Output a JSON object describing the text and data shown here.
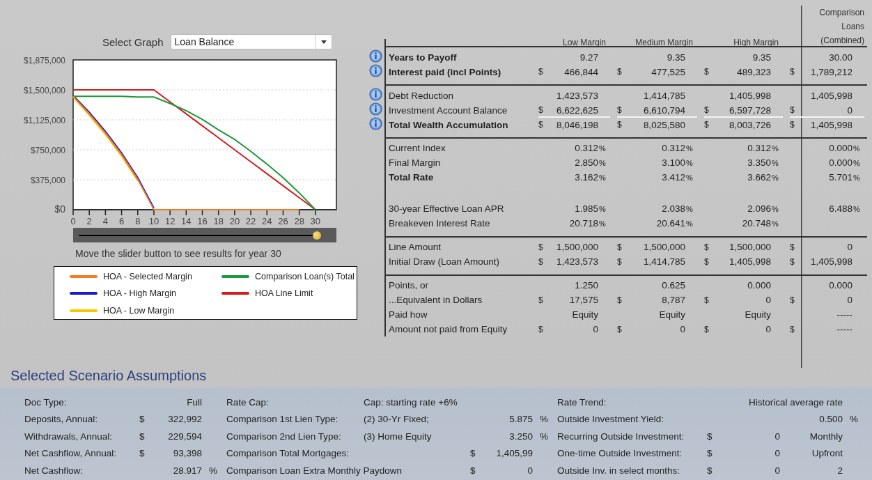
{
  "graph_selector": {
    "label": "Select Graph",
    "value": "Loan Balance"
  },
  "chart": {
    "chart_data": {
      "type": "line",
      "grid": true,
      "x": [
        0,
        2,
        4,
        6,
        8,
        10,
        12,
        14,
        16,
        18,
        20,
        22,
        24,
        26,
        28,
        30
      ],
      "xlim": [
        0,
        32.6
      ],
      "ylim": [
        0,
        1875000
      ],
      "xticks": [
        0,
        2,
        4,
        6,
        8,
        10,
        12,
        14,
        16,
        18,
        20,
        22,
        24,
        26,
        28,
        30
      ],
      "yticks": [
        {
          "value": 0,
          "label": "$0"
        },
        {
          "value": 375000,
          "label": "$375,000"
        },
        {
          "value": 750000,
          "label": "$750,000"
        },
        {
          "value": 1125000,
          "label": "$1,125,000"
        },
        {
          "value": 1500000,
          "label": "$1,500,000"
        },
        {
          "value": 1875000,
          "label": "$1,875,000"
        }
      ],
      "series": [
        {
          "name": "HOA - Selected Margin",
          "color": "#f47b20",
          "values": [
            1420000,
            1200000,
            960000,
            690000,
            380000,
            0,
            0,
            0,
            0,
            0,
            0,
            0,
            0,
            0,
            0,
            null
          ]
        },
        {
          "name": "Comparison Loan(s) Total",
          "color": "#1a9a3a",
          "values": [
            1420000,
            1420000,
            1420000,
            1420000,
            1410000,
            1410000,
            1330000,
            1240000,
            1130000,
            1000000,
            880000,
            730000,
            570000,
            400000,
            210000,
            0
          ]
        },
        {
          "name": "HOA - High Margin",
          "color": "#1818d8",
          "values": [
            1430000,
            1220000,
            980000,
            710000,
            400000,
            20000,
            null,
            null,
            null,
            null,
            null,
            null,
            null,
            null,
            null,
            null
          ]
        },
        {
          "name": "HOA Line Limit",
          "color": "#d41c1c",
          "values": [
            1500000,
            1500000,
            1500000,
            1500000,
            1500000,
            1500000,
            1350000,
            1200000,
            1050000,
            900000,
            750000,
            600000,
            450000,
            300000,
            150000,
            0
          ]
        },
        {
          "name": "HOA - Low Margin",
          "color": "#f5c800",
          "values": [
            1410000,
            1180000,
            940000,
            670000,
            360000,
            null,
            null,
            null,
            null,
            null,
            null,
            null,
            null,
            null,
            null,
            null
          ]
        }
      ]
    }
  },
  "slider": {
    "level": 1,
    "caption": "Move the slider button to see results for year  30"
  },
  "table": {
    "columns": [
      "Low Margin",
      "Medium Margin",
      "High Margin",
      "Comparison Loans (Combined)"
    ],
    "sections": [
      {
        "groups": [
          [
            {
              "label": "Years to Payoff",
              "info": true,
              "bold": true,
              "cells": [
                {
                  "value": "9.27"
                },
                {
                  "value": "9.35"
                },
                {
                  "value": "9.35"
                },
                {
                  "value": "30.00"
                }
              ]
            },
            {
              "label": "Interest paid (incl Points)",
              "info": true,
              "bold": true,
              "cells": [
                {
                  "currency": "$",
                  "value": "466,844"
                },
                {
                  "currency": "$",
                  "value": "477,525"
                },
                {
                  "currency": "$",
                  "value": "489,323"
                },
                {
                  "currency": "$",
                  "value": "1,789,212"
                }
              ]
            }
          ]
        ]
      },
      {
        "groups": [
          [
            {
              "label": "Debt Reduction",
              "info": true,
              "bold": false,
              "underline": false,
              "cells": [
                {
                  "value": "1,423,573"
                },
                {
                  "value": "1,414,785"
                },
                {
                  "value": "1,405,998"
                },
                {
                  "value": "1,405,998"
                }
              ]
            },
            {
              "label": "Investment Account Balance",
              "info": true,
              "bold": false,
              "underline": true,
              "cells": [
                {
                  "currency": "$",
                  "value": "6,622,625"
                },
                {
                  "currency": "$",
                  "value": "6,610,794"
                },
                {
                  "currency": "$",
                  "value": "6,597,728"
                },
                {
                  "currency": "$",
                  "value": "0"
                }
              ]
            },
            {
              "label": "Total Wealth Accumulation",
              "info": true,
              "bold": true,
              "underline": false,
              "cells": [
                {
                  "currency": "$",
                  "value": "8,046,198"
                },
                {
                  "currency": "$",
                  "value": "8,025,580"
                },
                {
                  "currency": "$",
                  "value": "8,003,726"
                },
                {
                  "currency": "$",
                  "value": "1,405,998"
                }
              ]
            }
          ]
        ]
      },
      {
        "groups": [
          [
            {
              "label": "Current Index",
              "bold": false,
              "cells": [
                {
                  "value": "0.312",
                  "unit": "%"
                },
                {
                  "value": "0.312",
                  "unit": "%"
                },
                {
                  "value": "0.312",
                  "unit": "%"
                },
                {
                  "value": "0.000",
                  "unit": "%"
                }
              ]
            },
            {
              "label": "Final Margin",
              "bold": false,
              "cells": [
                {
                  "value": "2.850",
                  "unit": "%"
                },
                {
                  "value": "3.100",
                  "unit": "%"
                },
                {
                  "value": "3.350",
                  "unit": "%"
                },
                {
                  "value": "0.000",
                  "unit": "%"
                }
              ]
            },
            {
              "label": "Total Rate",
              "bold": true,
              "cells": [
                {
                  "value": "3.162",
                  "unit": "%"
                },
                {
                  "value": "3.412",
                  "unit": "%"
                },
                {
                  "value": "3.662",
                  "unit": "%"
                },
                {
                  "value": "5.701",
                  "unit": "%"
                }
              ]
            }
          ],
          [
            {
              "label": "30-year Effective Loan APR",
              "cells": [
                {
                  "value": "1.985",
                  "unit": "%"
                },
                {
                  "value": "2.038",
                  "unit": "%"
                },
                {
                  "value": "2.096",
                  "unit": "%"
                },
                {
                  "value": "6.488",
                  "unit": "%"
                }
              ]
            },
            {
              "label": "Breakeven Interest Rate",
              "cells": [
                {
                  "value": "20.718",
                  "unit": "%"
                },
                {
                  "value": "20.641",
                  "unit": "%"
                },
                {
                  "value": "20.748",
                  "unit": "%"
                }
              ]
            }
          ]
        ]
      },
      {
        "groups": [
          [
            {
              "label": "Line Amount",
              "cells": [
                {
                  "currency": "$",
                  "value": "1,500,000"
                },
                {
                  "currency": "$",
                  "value": "1,500,000"
                },
                {
                  "currency": "$",
                  "value": "1,500,000"
                },
                {
                  "currency": "$",
                  "value": "0"
                }
              ]
            },
            {
              "label": "Initial Draw (Loan Amount)",
              "cells": [
                {
                  "currency": "$",
                  "value": "1,423,573"
                },
                {
                  "currency": "$",
                  "value": "1,414,785"
                },
                {
                  "currency": "$",
                  "value": "1,405,998"
                },
                {
                  "currency": "$",
                  "value": "1,405,998"
                }
              ]
            }
          ]
        ]
      },
      {
        "groups": [
          [
            {
              "label": "Points, or",
              "cells": [
                {
                  "value": "1.250"
                },
                {
                  "value": "0.625"
                },
                {
                  "value": "0.000"
                },
                {
                  "value": "0.000"
                }
              ]
            },
            {
              "label": "...Equivalent in Dollars",
              "cells": [
                {
                  "currency": "$",
                  "value": "17,575"
                },
                {
                  "currency": "$",
                  "value": "8,787"
                },
                {
                  "currency": "$",
                  "value": "0"
                },
                {
                  "currency": "$",
                  "value": "0"
                }
              ]
            },
            {
              "label": "Paid how",
              "cells": [
                {
                  "value": "Equity"
                },
                {
                  "value": "Equity"
                },
                {
                  "value": "Equity"
                },
                {
                  "value": "-----"
                }
              ]
            },
            {
              "label": "Amount not paid from Equity",
              "cells": [
                {
                  "currency": "$",
                  "value": "0"
                },
                {
                  "currency": "$",
                  "value": "0"
                },
                {
                  "currency": "$",
                  "value": "0"
                },
                {
                  "currency": "$",
                  "value": "-----"
                }
              ]
            }
          ]
        ]
      }
    ]
  },
  "assumptions": {
    "title": "Selected Scenario Assumptions",
    "columns": [
      [
        {
          "label": "Doc Type:",
          "value": "Full"
        },
        {
          "label": "Deposits, Annual:",
          "currency": "$",
          "value": "322,992"
        },
        {
          "label": "Withdrawals, Annual:",
          "currency": "$",
          "value": "229,594"
        },
        {
          "label": "Net Cashflow, Annual:",
          "currency": "$",
          "value": "93,398"
        },
        {
          "label": "Net Cashflow:",
          "value": "28.917",
          "unit": "%"
        }
      ],
      [
        {
          "label": "Rate Cap:",
          "detail": "Cap: starting rate +6%"
        },
        {
          "label": "Comparison 1st Lien Type:",
          "detail": "(2)  30-Yr Fixed;",
          "value": "5.875",
          "unit": "%"
        },
        {
          "label": "Comparison 2nd Lien Type:",
          "detail": "(3)  Home Equity",
          "value": "3.250",
          "unit": "%"
        },
        {
          "label": "Comparison Total Mortgages:",
          "currency": "$",
          "value": "1,405,99"
        },
        {
          "label": "Comparison Loan Extra Monthly Paydown",
          "currency": "$",
          "value": "0"
        }
      ],
      [
        {
          "label": "Rate Trend:",
          "detail": "Historical average rate"
        },
        {
          "label": "Outside Investment Yield:",
          "extra": "0.500",
          "unit": "%"
        },
        {
          "label": "Recurring Outside Investment:",
          "currency": "$",
          "value": "0",
          "extra": "Monthly"
        },
        {
          "label": "One-time Outside Investment:",
          "currency": "$",
          "value": "0",
          "extra": "Upfront"
        },
        {
          "label": "Outside Inv. in select months:",
          "currency": "$",
          "value": "0",
          "extra": "2"
        }
      ]
    ]
  }
}
